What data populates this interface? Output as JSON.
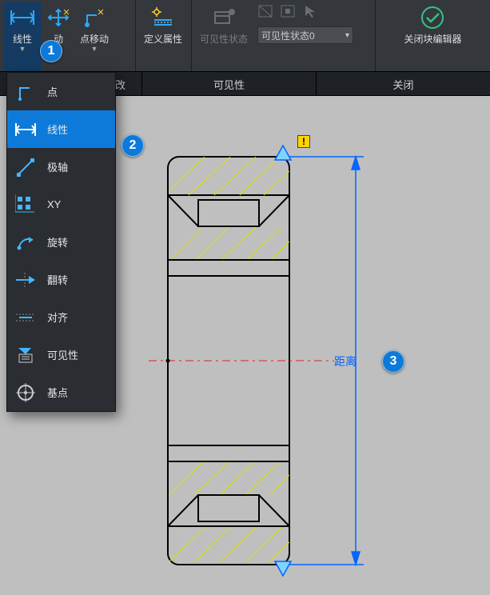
{
  "ribbon": {
    "linear": {
      "label": "线性"
    },
    "move": {
      "label": "动"
    },
    "ptmove": {
      "label": "点移动"
    },
    "defattr": {
      "label": "定义属性"
    },
    "visstate": {
      "label": "可见性状态"
    },
    "viscombo": {
      "value": "可见性状态0"
    },
    "closeed": {
      "label": "关闭块编辑器"
    }
  },
  "tabs": {
    "t1": "改",
    "t2": "可见性",
    "t3": "关闭"
  },
  "dropdown": {
    "items": [
      {
        "label": "点"
      },
      {
        "label": "线性"
      },
      {
        "label": "极轴"
      },
      {
        "label": "XY"
      },
      {
        "label": "旋转"
      },
      {
        "label": "翻转"
      },
      {
        "label": "对齐"
      },
      {
        "label": "可见性"
      },
      {
        "label": "基点"
      }
    ]
  },
  "markers": {
    "m1": "1",
    "m2": "2",
    "m3": "3"
  },
  "dimension": {
    "label": "距离"
  },
  "warn": {
    "glyph": "!"
  }
}
